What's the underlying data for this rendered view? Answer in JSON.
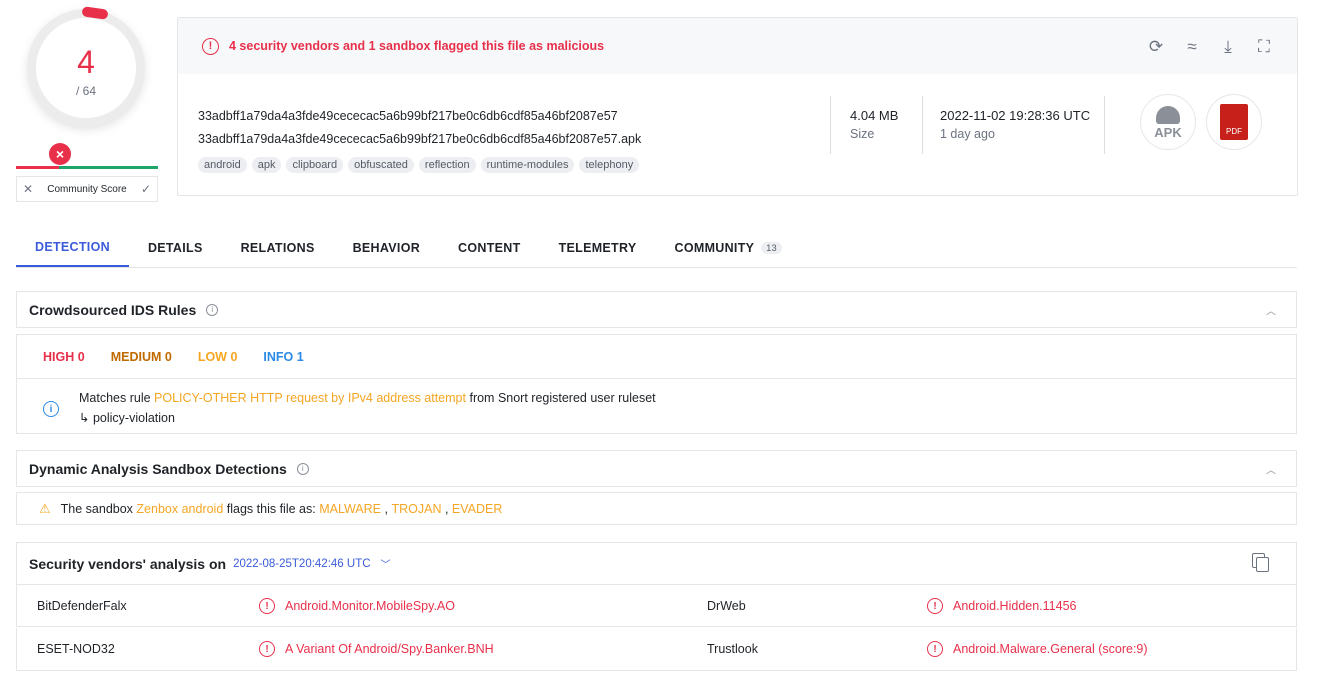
{
  "score": {
    "detections": "4",
    "total": "/ 64",
    "community_label": "Community Score"
  },
  "alert": {
    "text": "4 security vendors and 1 sandbox flagged this file as malicious"
  },
  "file": {
    "hash": "33adbff1a79da4a3fde49cececac5a6b99bf217be0c6db6cdf85a46bf2087e57",
    "name": "33adbff1a79da4a3fde49cececac5a6b99bf217be0c6db6cdf85a46bf2087e57.apk",
    "tags": [
      "android",
      "apk",
      "clipboard",
      "obfuscated",
      "reflection",
      "runtime-modules",
      "telephony"
    ],
    "size": "4.04 MB",
    "size_label": "Size",
    "date": "2022-11-02 19:28:36 UTC",
    "date_ago": "1 day ago",
    "type_apk": "APK",
    "type_pdf": "PDF"
  },
  "tabs": [
    {
      "label": "DETECTION"
    },
    {
      "label": "DETAILS"
    },
    {
      "label": "RELATIONS"
    },
    {
      "label": "BEHAVIOR"
    },
    {
      "label": "CONTENT"
    },
    {
      "label": "TELEMETRY"
    },
    {
      "label": "COMMUNITY",
      "badge": "13"
    }
  ],
  "ids": {
    "title": "Crowdsourced IDS Rules",
    "high": "HIGH 0",
    "medium": "MEDIUM 0",
    "low": "LOW 0",
    "info": "INFO 1",
    "rule_prefix": "Matches rule",
    "rule_name": "POLICY-OTHER HTTP request by IPv4 address attempt",
    "rule_suffix": "from Snort registered user ruleset",
    "rule_arrow": "↳",
    "rule_class": "policy-violation"
  },
  "sandbox": {
    "title": "Dynamic Analysis Sandbox Detections",
    "prefix": "The sandbox",
    "name": "Zenbox android",
    "middle": "flags this file as:",
    "flags": [
      "MALWARE",
      "TROJAN",
      "EVADER"
    ],
    "sep": ","
  },
  "vendors": {
    "title": "Security vendors' analysis on",
    "date": "2022-08-25T20:42:46 UTC",
    "rows": [
      {
        "left_name": "BitDefenderFalx",
        "left_result": "Android.Monitor.MobileSpy.AO",
        "right_name": "DrWeb",
        "right_result": "Android.Hidden.11456"
      },
      {
        "left_name": "ESET-NOD32",
        "left_result": "A Variant Of Android/Spy.Banker.BNH",
        "right_name": "Trustlook",
        "right_result": "Android.Malware.General (score:9)"
      }
    ]
  }
}
